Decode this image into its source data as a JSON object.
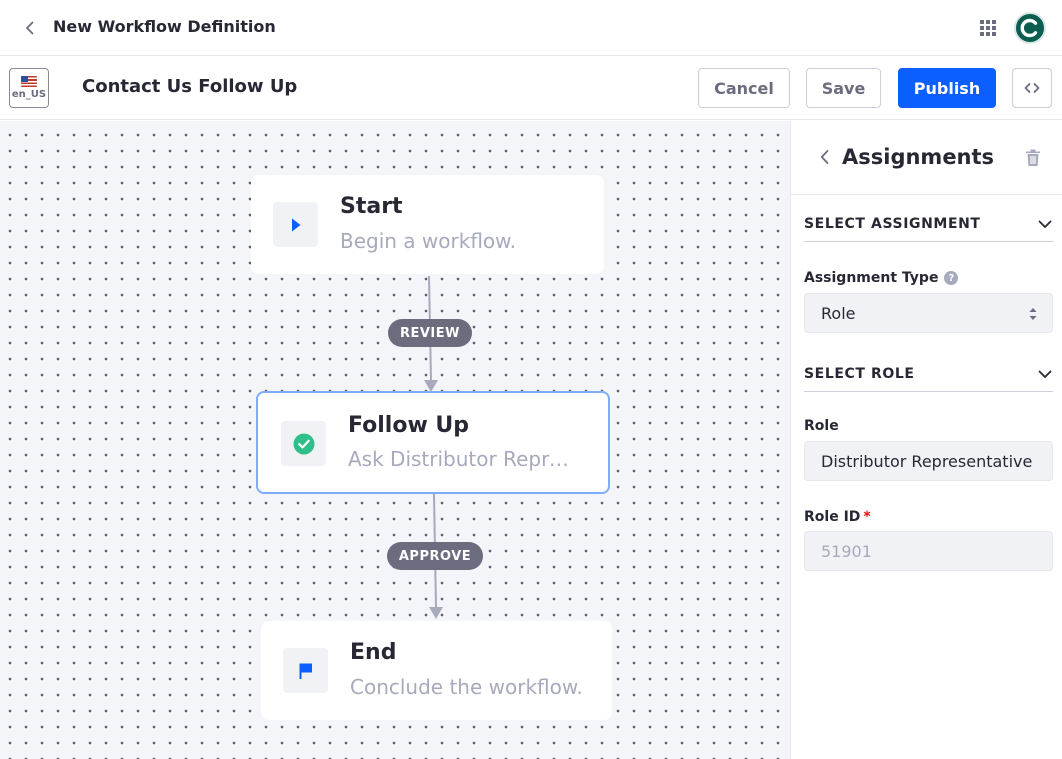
{
  "header": {
    "title": "New Workflow Definition",
    "icons": {
      "back": "chevron-left-icon",
      "apps": "apps-grid-icon",
      "avatar": "user-avatar"
    },
    "avatar_color": "#0b5d4f",
    "avatar_letter": "C"
  },
  "toolbar": {
    "language": "en_US",
    "definition_name": "Contact Us Follow Up",
    "cancel_label": "Cancel",
    "save_label": "Save",
    "publish_label": "Publish",
    "code_icon": "code-icon"
  },
  "canvas": {
    "nodes": [
      {
        "title": "Start",
        "description": "Begin a workflow.",
        "icon": "play-icon"
      },
      {
        "title": "Follow Up",
        "description": "Ask Distributor Representative to follow up",
        "icon": "check-circle-icon"
      },
      {
        "title": "End",
        "description": "Conclude the workflow.",
        "icon": "flag-icon"
      }
    ],
    "transitions": [
      {
        "label": "REVIEW"
      },
      {
        "label": "APPROVE"
      }
    ]
  },
  "panel": {
    "title": "Assignments",
    "sections": {
      "select_assignment": "SELECT ASSIGNMENT",
      "select_role": "SELECT ROLE"
    },
    "assignment_type_label": "Assignment Type",
    "assignment_type_value": "Role",
    "role_label": "Role",
    "role_value": "Distributor Representative",
    "role_id_label": "Role ID",
    "role_id_required": "*",
    "role_id_value": "51901"
  },
  "colors": {
    "primary": "#0b5fff",
    "selected_border": "#80acff",
    "edge": "#a7a9bc",
    "edge_label_bg": "#6b6c7e",
    "start_icon": "#0b5fff",
    "task_icon": "#2fbf8a",
    "end_icon": "#0b5fff"
  }
}
